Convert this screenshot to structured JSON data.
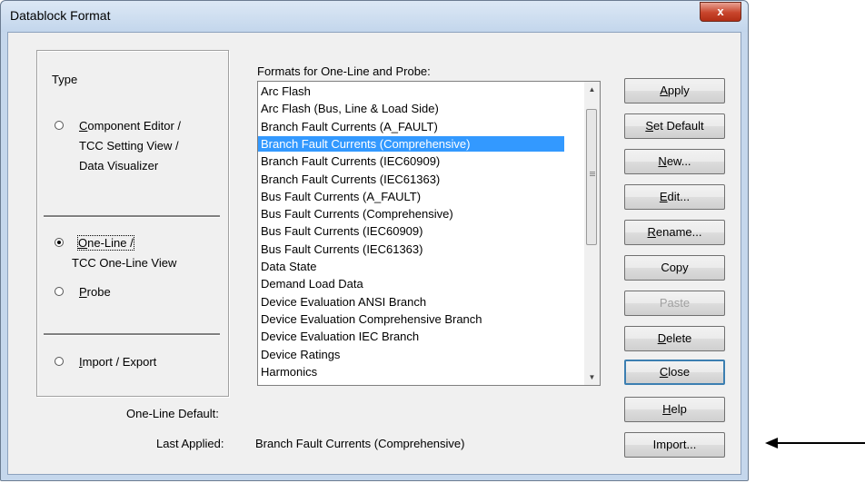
{
  "window": {
    "title": "Datablock Format",
    "close_glyph": "x"
  },
  "type_group": {
    "label": "Type",
    "options": [
      {
        "lines": [
          "Component Editor /",
          "TCC Setting View /",
          "Data Visualizer"
        ],
        "selected": false
      },
      {
        "lines": [
          "One-Line /",
          "TCC One-Line View"
        ],
        "selected": true
      },
      {
        "lines": [
          "Probe"
        ],
        "selected": false
      },
      {
        "lines": [
          "Import / Export"
        ],
        "selected": false
      }
    ]
  },
  "formats": {
    "label": "Formats for One-Line and Probe:",
    "items": [
      "Arc Flash",
      "Arc Flash (Bus, Line & Load Side)",
      "Branch Fault Currents (A_FAULT)",
      "Branch Fault Currents (Comprehensive)",
      "Branch Fault Currents (IEC60909)",
      "Branch Fault Currents (IEC61363)",
      "Bus Fault Currents (A_FAULT)",
      "Bus Fault Currents (Comprehensive)",
      "Bus Fault Currents (IEC60909)",
      "Bus Fault Currents (IEC61363)",
      "Data State",
      "Demand Load Data",
      "Device Evaluation ANSI Branch",
      "Device Evaluation Comprehensive Branch",
      "Device Evaluation IEC Branch",
      "Device Ratings",
      "Harmonics"
    ],
    "selected_index": 3
  },
  "footer": {
    "one_line_default_label": "One-Line Default:",
    "one_line_default_value": "",
    "last_applied_label": "Last Applied:",
    "last_applied_value": "Branch Fault Currents (Comprehensive)"
  },
  "buttons": {
    "apply": "Apply",
    "set_default": "Set Default",
    "new": "New...",
    "edit": "Edit...",
    "rename": "Rename...",
    "copy": "Copy",
    "paste": "Paste",
    "delete": "Delete",
    "close": "Close",
    "help": "Help",
    "import": "Import..."
  },
  "annotation": {
    "arrow_icon": "left-arrow-icon"
  }
}
